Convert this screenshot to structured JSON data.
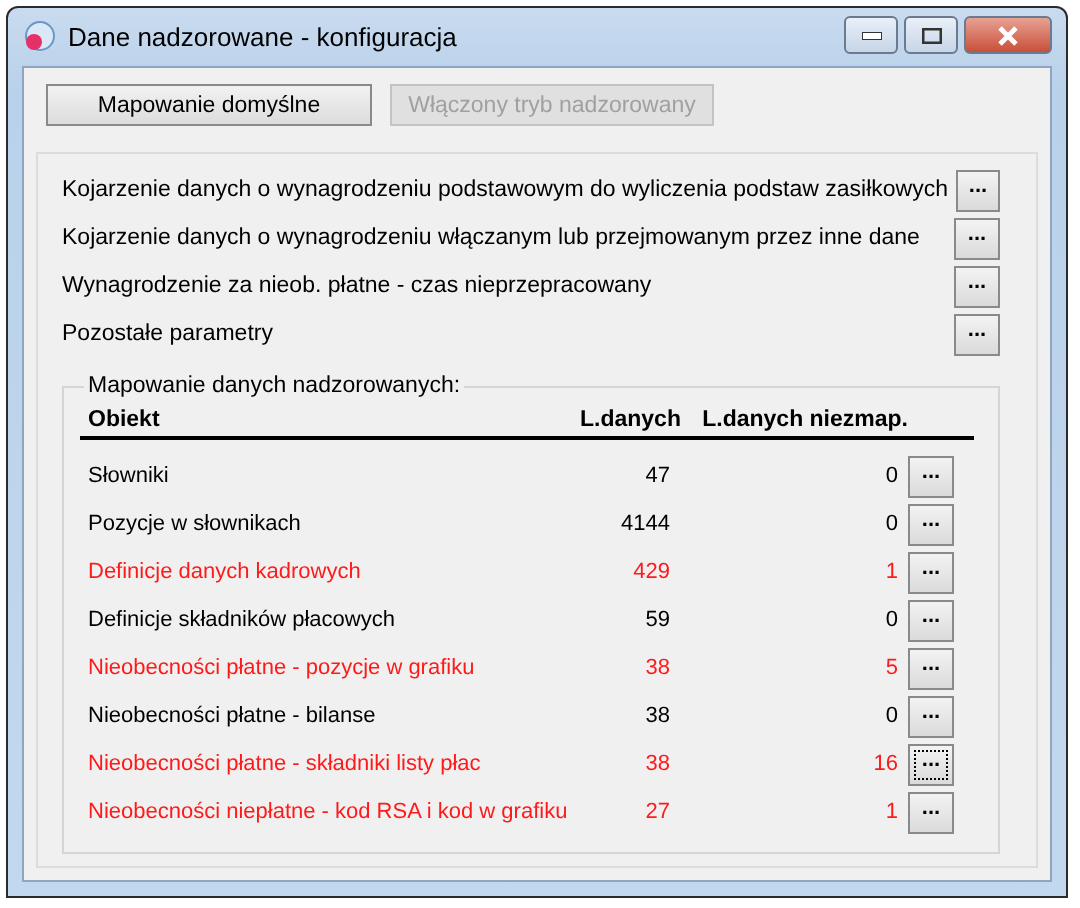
{
  "window": {
    "title": "Dane nadzorowane - konfiguracja"
  },
  "top_buttons": [
    {
      "label": "Mapowanie domyślne",
      "disabled": false
    },
    {
      "label": "Włączony tryb nadzorowany",
      "disabled": true
    }
  ],
  "settings": [
    {
      "label": "Kojarzenie danych o wynagrodzeniu podstawowym do wyliczenia podstaw zasiłkowych",
      "button": "..."
    },
    {
      "label": "Kojarzenie danych o wynagrodzeniu włączanym lub przejmowanym przez inne dane",
      "button": "..."
    },
    {
      "label": "Wynagrodzenie za nieob. płatne - czas nieprzepracowany",
      "button": "..."
    },
    {
      "label": "Pozostałe parametry",
      "button": "..."
    }
  ],
  "mapping": {
    "title": "Mapowanie danych nadzorowanych:",
    "columns": [
      "Obiekt",
      "L.danych",
      "L.danych niezmap."
    ],
    "rows": [
      {
        "name": "Słowniki",
        "count": "47",
        "unmapped": "0",
        "warning": false,
        "button": "...",
        "focused": false
      },
      {
        "name": "Pozycje w słownikach",
        "count": "4144",
        "unmapped": "0",
        "warning": false,
        "button": "...",
        "focused": false
      },
      {
        "name": "Definicje danych kadrowych",
        "count": "429",
        "unmapped": "1",
        "warning": true,
        "button": "...",
        "focused": false
      },
      {
        "name": "Definicje składników płacowych",
        "count": "59",
        "unmapped": "0",
        "warning": false,
        "button": "...",
        "focused": false
      },
      {
        "name": "Nieobecności płatne - pozycje w grafiku",
        "count": "38",
        "unmapped": "5",
        "warning": true,
        "button": "...",
        "focused": false
      },
      {
        "name": "Nieobecności płatne - bilanse",
        "count": "38",
        "unmapped": "0",
        "warning": false,
        "button": "...",
        "focused": false
      },
      {
        "name": "Nieobecności płatne - składniki listy płac",
        "count": "38",
        "unmapped": "16",
        "warning": true,
        "button": "...",
        "focused": true
      },
      {
        "name": "Nieobecności niepłatne - kod RSA i kod w grafiku",
        "count": "27",
        "unmapped": "1",
        "warning": true,
        "button": "...",
        "focused": false
      }
    ]
  }
}
